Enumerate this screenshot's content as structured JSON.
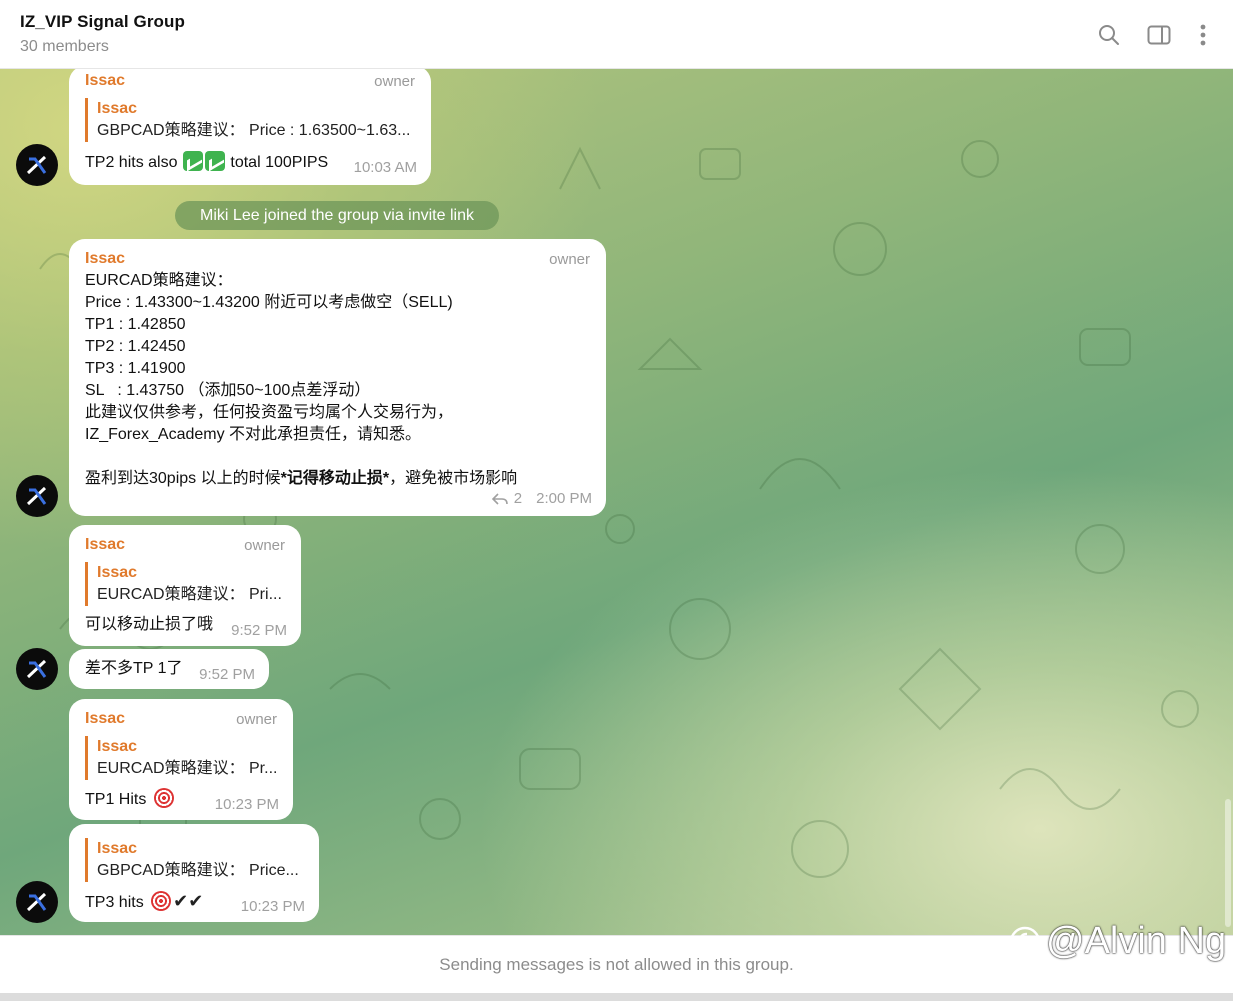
{
  "header": {
    "title": "IZ_VIP Signal Group",
    "subtitle": "30 members",
    "icons": [
      "search-icon",
      "sidebar-toggle-icon",
      "more-vertical-icon"
    ]
  },
  "messages": [
    {
      "sender": "Issac",
      "role": "owner",
      "reply_to": {
        "name": "Issac",
        "text": "GBPCAD策略建议： Price : 1.63500~1.63..."
      },
      "text_before": "TP2 hits also ",
      "text_after": " total 100PIPS",
      "time": "10:03 AM"
    },
    {
      "service": "Miki Lee joined the group via invite link"
    },
    {
      "sender": "Issac",
      "role": "owner",
      "lines": [
        "EURCAD策略建议：",
        "Price : 1.43300~1.43200 附近可以考虑做空（SELL)",
        "TP1 : 1.42850",
        "TP2 : 1.42450",
        "TP3 : 1.41900",
        "SL   : 1.43750 （添加50~100点差浮动）",
        "此建议仅供参考，任何投资盈亏均属个人交易行为，",
        "IZ_Forex_Academy 不对此承担责任，请知悉。",
        ""
      ],
      "last_line_a": "盈利到达30pips 以上的时候",
      "last_line_bold": "*记得移动止损*",
      "last_line_b": "，避免被市场影响",
      "replies": "2",
      "time": "2:00 PM"
    },
    {
      "sender": "Issac",
      "role": "owner",
      "reply_to": {
        "name": "Issac",
        "text": "EURCAD策略建议： Pri..."
      },
      "text": "可以移动止损了哦",
      "time": "9:52 PM"
    },
    {
      "text": "差不多TP 1了",
      "time": "9:52 PM"
    },
    {
      "sender": "Issac",
      "role": "owner",
      "reply_to": {
        "name": "Issac",
        "text": "EURCAD策略建议： Pr..."
      },
      "text": "TP1 Hits ",
      "time": "10:23 PM"
    },
    {
      "reply_to": {
        "name": "Issac",
        "text": "GBPCAD策略建议： Price..."
      },
      "text": "TP3 hits ",
      "checks": "✔✔",
      "time": "10:23 PM"
    }
  ],
  "footer": {
    "text": "Sending messages is not allowed in this group."
  },
  "watermark": "@Alvin Ng",
  "colors": {
    "accent": "#e07a2c",
    "chat_bg": "#8fb57a"
  }
}
